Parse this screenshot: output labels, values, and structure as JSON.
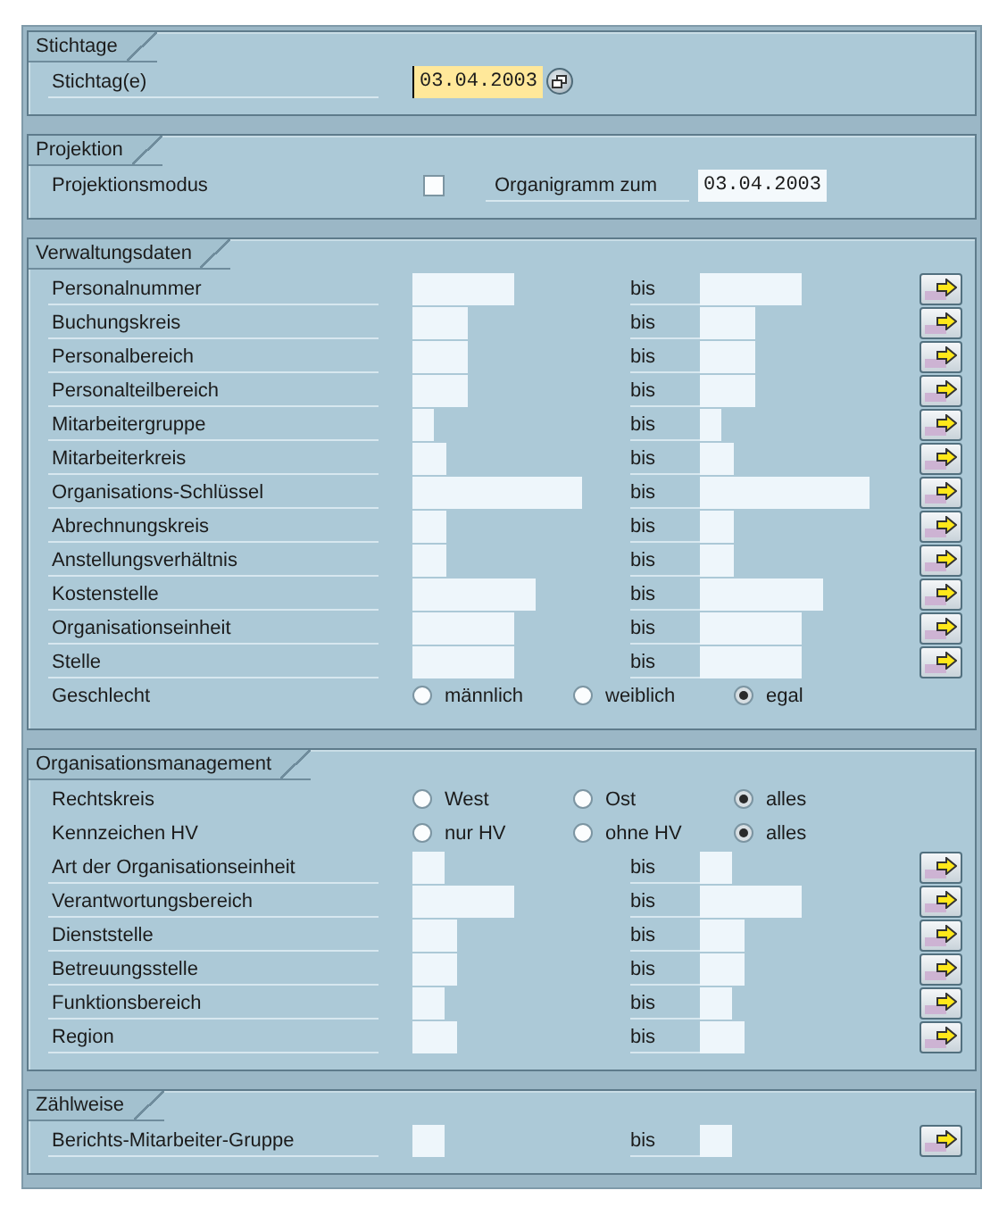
{
  "sections": [
    {
      "title": "Stichtage",
      "rows": [
        {
          "kind": "date",
          "label": "Stichtag(e)",
          "value": "03.04.2003",
          "focused": true
        }
      ]
    },
    {
      "title": "Projektion",
      "rows": [
        {
          "kind": "check",
          "label": "Projektionsmodus",
          "checked": false,
          "date_label": "Organigramm zum",
          "date_value": "03.04.2003"
        }
      ]
    },
    {
      "title": "Verwaltungsdaten",
      "rows": [
        {
          "kind": "range",
          "label": "Personalnummer",
          "to_label": "bis"
        },
        {
          "kind": "range",
          "label": "Buchungskreis",
          "to_label": "bis"
        },
        {
          "kind": "range",
          "label": "Personalbereich",
          "to_label": "bis"
        },
        {
          "kind": "range",
          "label": "Personalteilbereich",
          "to_label": "bis"
        },
        {
          "kind": "range",
          "label": "Mitarbeitergruppe",
          "to_label": "bis"
        },
        {
          "kind": "range",
          "label": "Mitarbeiterkreis",
          "to_label": "bis"
        },
        {
          "kind": "range",
          "label": "Organisations-Schlüssel",
          "to_label": "bis"
        },
        {
          "kind": "range",
          "label": "Abrechnungskreis",
          "to_label": "bis"
        },
        {
          "kind": "range",
          "label": "Anstellungsverhältnis",
          "to_label": "bis"
        },
        {
          "kind": "range",
          "label": "Kostenstelle",
          "to_label": "bis"
        },
        {
          "kind": "range",
          "label": "Organisationseinheit",
          "to_label": "bis"
        },
        {
          "kind": "range",
          "label": "Stelle",
          "to_label": "bis"
        },
        {
          "kind": "radio",
          "label": "Geschlecht",
          "options": [
            {
              "label": "männlich",
              "selected": false
            },
            {
              "label": "weiblich",
              "selected": false
            },
            {
              "label": "egal",
              "selected": true
            }
          ]
        }
      ]
    },
    {
      "title": "Organisationsmanagement",
      "rows": [
        {
          "kind": "radio",
          "label": "Rechtskreis",
          "options": [
            {
              "label": "West",
              "selected": false
            },
            {
              "label": "Ost",
              "selected": false
            },
            {
              "label": "alles",
              "selected": true
            }
          ]
        },
        {
          "kind": "radio",
          "label": "Kennzeichen HV",
          "options": [
            {
              "label": "nur HV",
              "selected": false
            },
            {
              "label": "ohne HV",
              "selected": false
            },
            {
              "label": "alles",
              "selected": true
            }
          ]
        },
        {
          "kind": "range",
          "label": "Art der Organisationseinheit",
          "to_label": "bis"
        },
        {
          "kind": "range",
          "label": "Verantwortungsbereich",
          "to_label": "bis"
        },
        {
          "kind": "range",
          "label": "Dienststelle",
          "to_label": "bis"
        },
        {
          "kind": "range",
          "label": "Betreuungsstelle",
          "to_label": "bis"
        },
        {
          "kind": "range",
          "label": "Funktionsbereich",
          "to_label": "bis"
        },
        {
          "kind": "range",
          "label": "Region",
          "to_label": "bis"
        }
      ]
    },
    {
      "title": "Zählweise",
      "rows": [
        {
          "kind": "range",
          "label": "Berichts-Mitarbeiter-Gruppe",
          "to_label": "bis"
        }
      ]
    }
  ]
}
